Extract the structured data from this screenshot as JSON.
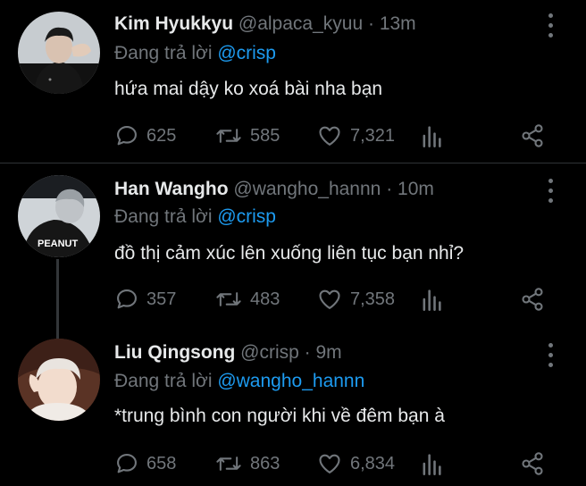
{
  "tweets": [
    {
      "name": "Kim Hyukkyu",
      "handle": "@alpaca_kyuu",
      "sep": "·",
      "time": "13m",
      "replying_prefix": "Đang trả lời ",
      "replying_to": "@crisp",
      "text": "hứa mai dậy ko xoá bài nha bạn",
      "replies": "625",
      "retweets": "585",
      "likes": "7,321"
    },
    {
      "name": "Han Wangho",
      "handle": "@wangho_hannn",
      "sep": "·",
      "time": "10m",
      "replying_prefix": "Đang trả lời ",
      "replying_to": "@crisp",
      "text": "đồ thị cảm xúc lên xuống liên tục bạn nhỉ?",
      "replies": "357",
      "retweets": "483",
      "likes": "7,358",
      "avatar_caption": "PEANUT"
    },
    {
      "name": "Liu Qingsong",
      "handle": "@crisp",
      "sep": "·",
      "time": "9m",
      "replying_prefix": "Đang trả lời ",
      "replying_to": "@wangho_hannn",
      "text": "*trung bình con người khi về đêm bạn à",
      "replies": "658",
      "retweets": "863",
      "likes": "6,834"
    }
  ],
  "icons": {
    "reply": "reply-icon",
    "retweet": "retweet-icon",
    "like": "heart-icon",
    "analytics": "analytics-icon",
    "share": "share-icon",
    "more": "more-vertical-icon"
  },
  "colors": {
    "background": "#000000",
    "text": "#e7e9ea",
    "muted": "#71767b",
    "link": "#1d9bf0",
    "divider": "#2f3336"
  }
}
